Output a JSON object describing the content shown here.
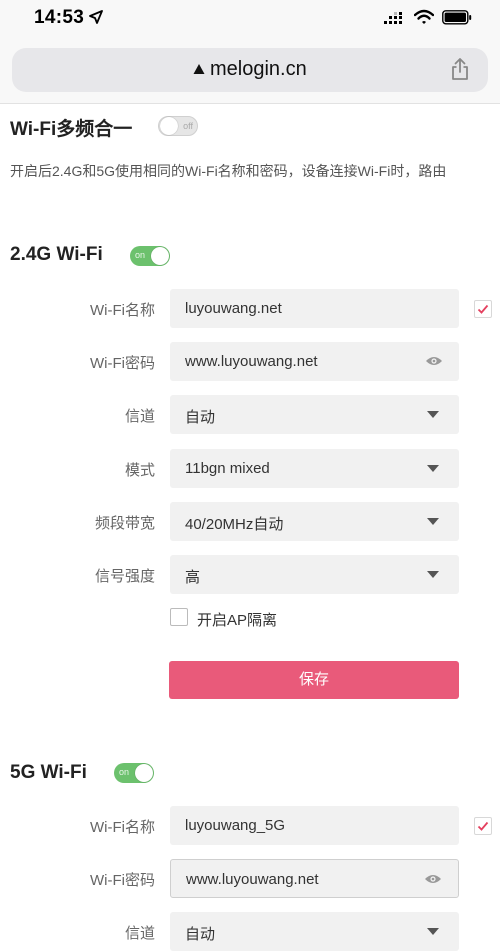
{
  "status_bar": {
    "time": "14:53",
    "icons": [
      "location-arrow-icon",
      "cellular-signal-icon",
      "wifi-signal-icon",
      "battery-icon"
    ]
  },
  "browser": {
    "url": "melogin.cn",
    "secure_icon": "lock-icon",
    "share_icon": "share-icon"
  },
  "multi_band": {
    "title": "Wi-Fi多频合一",
    "toggle_label": "off",
    "enabled": false,
    "description": "开启后2.4G和5G使用相同的Wi-Fi名称和密码，设备连接Wi-Fi时，路由"
  },
  "band_24": {
    "title": "2.4G Wi-Fi",
    "toggle_label": "on",
    "enabled": true,
    "ssid_label": "Wi-Fi名称",
    "ssid_value": "luyouwang.net",
    "password_label": "Wi-Fi密码",
    "password_value": "www.luyouwang.net",
    "channel_label": "信道",
    "channel_value": "自动",
    "mode_label": "模式",
    "mode_value": "11bgn mixed",
    "bandwidth_label": "频段带宽",
    "bandwidth_value": "40/20MHz自动",
    "power_label": "信号强度",
    "power_value": "高",
    "ap_isolation_label": "开启AP隔离",
    "save_label": "保存"
  },
  "band_5": {
    "title": "5G Wi-Fi",
    "toggle_label": "on",
    "enabled": true,
    "ssid_label": "Wi-Fi名称",
    "ssid_value": "luyouwang_5G",
    "password_label": "Wi-Fi密码",
    "password_value": "www.luyouwang.net",
    "channel_label": "信道",
    "channel_value": "自动"
  },
  "colors": {
    "accent_pink": "#e95a7a",
    "toggle_on": "#6cc16d",
    "check_red": "#e4405f"
  }
}
